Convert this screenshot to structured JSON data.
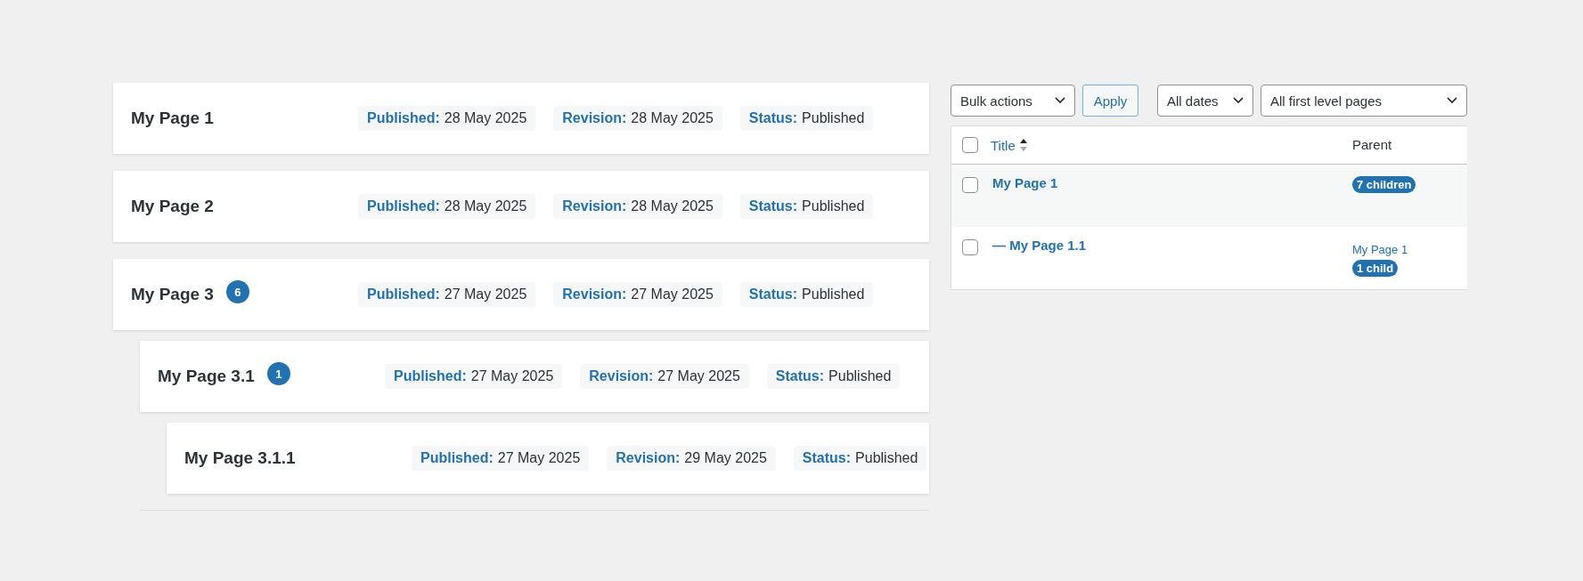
{
  "pages": [
    {
      "title": "My Page 1",
      "meta": [
        {
          "label": "Published:",
          "value": "28 May 2025"
        },
        {
          "label": "Revision:",
          "value": "28 May 2025"
        },
        {
          "label": "Status:",
          "value": "Published"
        }
      ]
    },
    {
      "title": "My Page 2",
      "meta": [
        {
          "label": "Published:",
          "value": "28 May 2025"
        },
        {
          "label": "Revision:",
          "value": "28 May 2025"
        },
        {
          "label": "Status:",
          "value": "Published"
        }
      ]
    },
    {
      "title": "My Page 3",
      "count": "6",
      "meta": [
        {
          "label": "Published:",
          "value": "27 May 2025"
        },
        {
          "label": "Revision:",
          "value": "27 May 2025"
        },
        {
          "label": "Status:",
          "value": "Published"
        }
      ],
      "children": [
        {
          "title": "My Page 3.1",
          "count": "1",
          "meta": [
            {
              "label": "Published:",
              "value": "27 May 2025"
            },
            {
              "label": "Revision:",
              "value": "27 May 2025"
            },
            {
              "label": "Status:",
              "value": "Published"
            }
          ],
          "children": [
            {
              "title": "My Page 3.1.1",
              "meta": [
                {
                  "label": "Published:",
                  "value": "27 May 2025"
                },
                {
                  "label": "Revision:",
                  "value": "29 May 2025"
                },
                {
                  "label": "Status:",
                  "value": "Published"
                }
              ]
            }
          ]
        }
      ]
    }
  ],
  "toolbar": {
    "bulk_actions": "Bulk actions",
    "apply_button": "Apply",
    "date_filter": "All dates",
    "parent_filter": "All first level pages"
  },
  "table": {
    "select_all_checked": false,
    "columns": [
      {
        "label": "Title",
        "sortable": true
      },
      {
        "label": "Parent",
        "sortable": false
      }
    ],
    "rows": [
      {
        "title": "My Page 1",
        "checked": false,
        "parent": null,
        "badge": "7 children"
      },
      {
        "title": "— My Page 1.1",
        "checked": false,
        "parent": "My Page 1",
        "badge": "1 child"
      }
    ]
  }
}
